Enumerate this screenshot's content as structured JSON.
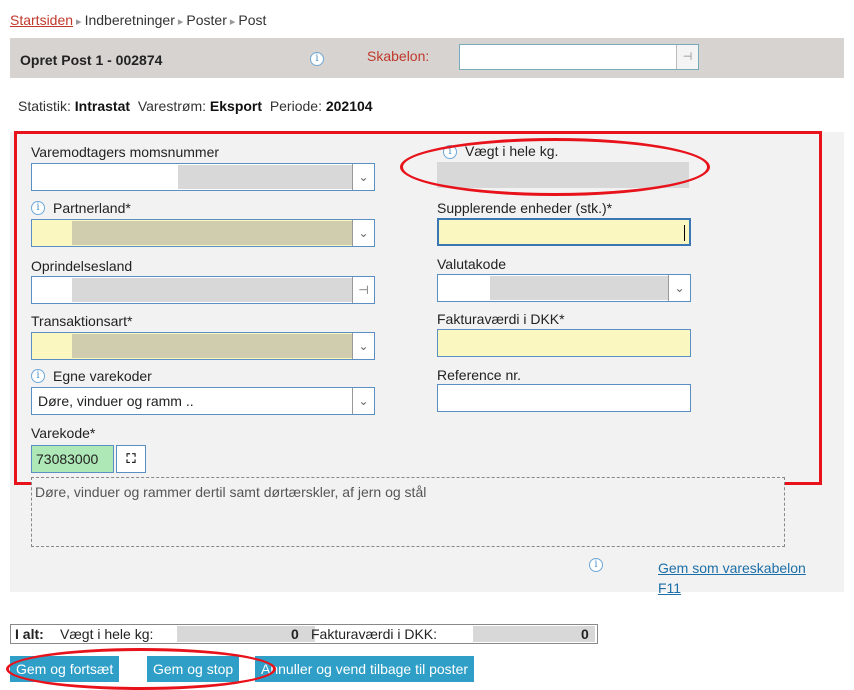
{
  "breadcrumb": {
    "home": "Startsiden",
    "items": [
      "Indberetninger",
      "Poster",
      "Post"
    ],
    "separator": "▸"
  },
  "header": {
    "title": "Opret Post 1 - 002874",
    "info_icon": "i",
    "skabelon_label": "Skabelon:",
    "skabelon_value": ""
  },
  "stats": {
    "statistik_label": "Statistik:",
    "statistik_value": "Intrastat",
    "varestrom_label": "Varestrøm:",
    "varestrom_value": "Eksport",
    "periode_label": "Periode:",
    "periode_value": "202104"
  },
  "form": {
    "momsnummer_label": "Varemodtagers momsnummer",
    "partnerland_label": "Partnerland*",
    "oprindelsesland_label": "Oprindelsesland",
    "transaktionsart_label": "Transaktionsart*",
    "egne_varekoder_label": "Egne varekoder",
    "egne_varekoder_value": "Døre, vinduer og ramm ..",
    "varekode_label": "Varekode*",
    "varekode_value": "73083000",
    "vaegt_label": "Vægt i hele kg.",
    "supplerende_label": "Supplerende enheder (stk.)*",
    "valutakode_label": "Valutakode",
    "fakturavaerdi_label": "Fakturaværdi i DKK*",
    "reference_label": "Reference nr.",
    "description": "Døre, vinduer og rammer dertil samt dørtærskler, af jern og stål"
  },
  "gem_link": {
    "line1": "Gem som vareskabelon",
    "line2": "F11"
  },
  "totals": {
    "label": "I alt:",
    "vaegt_label": "Vægt i hele kg:",
    "vaegt_value": "0",
    "faktura_label": "Fakturaværdi i DKK:",
    "faktura_value": "0"
  },
  "buttons": {
    "gem_fortsaet": "Gem og fortsæt",
    "gem_stop": "Gem og stop",
    "annuller": "Annuller og vend tilbage til poster"
  },
  "icons": {
    "dropdown": "chevron-double-down-icon",
    "lookup": "binoculars-icon",
    "info": "info-icon"
  },
  "colors": {
    "accent_button": "#2f9fc7",
    "required_field": "#fbf7c0",
    "highlight": "#e8121b",
    "varekode_bg": "#aee8b6"
  }
}
